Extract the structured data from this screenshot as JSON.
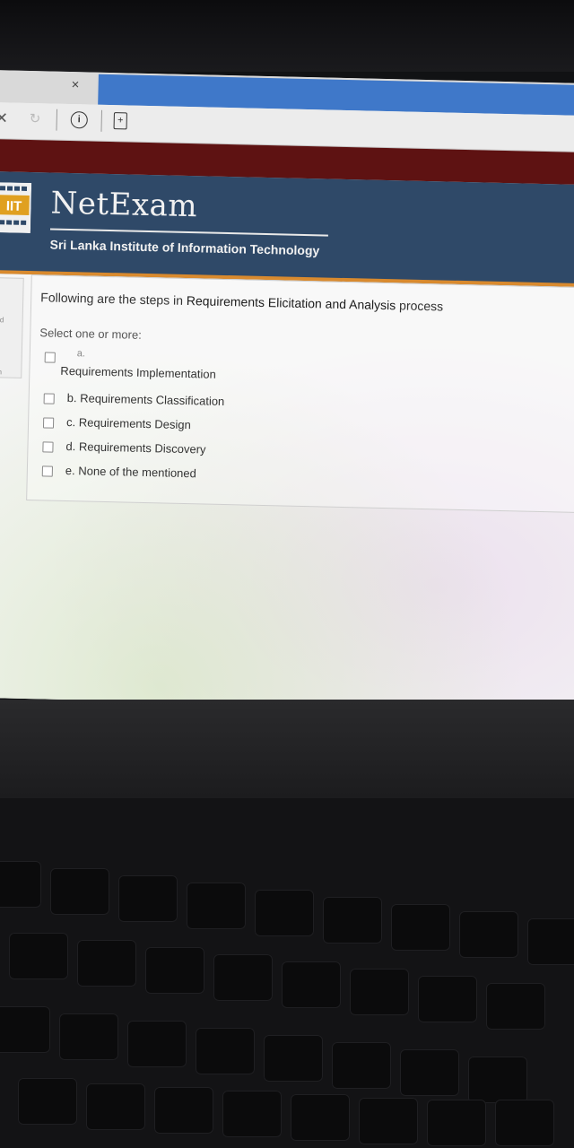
{
  "browser": {
    "tab_close_glyph": "×",
    "nav_stop_glyph": "✕",
    "nav_reload_glyph": "↻",
    "info_glyph": "i",
    "page_glyph": "+"
  },
  "header": {
    "brand": "NetExam",
    "institute": "Sri Lanka Institute of Information Technology",
    "colors": {
      "header_bg": "#2f4968",
      "accent": "#d98a2e",
      "top_bar": "#5e1212"
    }
  },
  "side": {
    "text1": "red",
    "text2": "ion"
  },
  "question": {
    "text_before": "Following are the steps in ",
    "text_bold": "Requirements Elicitation and Analysis",
    "text_after": " process",
    "select_label": "Select one or more:",
    "options": [
      {
        "letter": "a.",
        "label": "Requirements Implementation"
      },
      {
        "label": "b. Requirements Classification"
      },
      {
        "label": "c. Requirements Design"
      },
      {
        "label": "d. Requirements Discovery"
      },
      {
        "label": "e. None of the mentioned"
      }
    ]
  }
}
